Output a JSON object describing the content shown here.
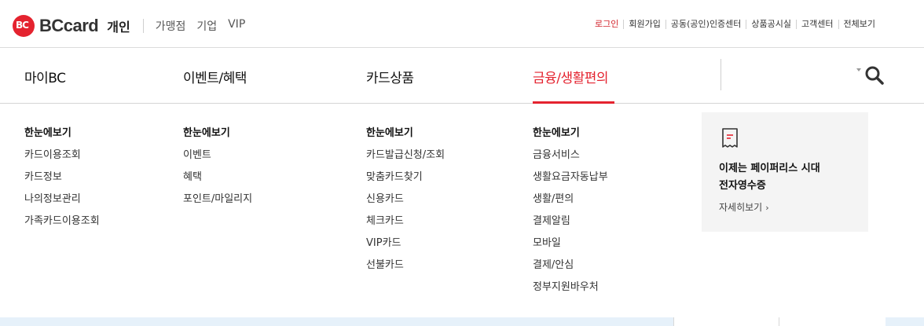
{
  "brand": {
    "logo_mark": "BC",
    "logo_text": "BCcard",
    "segment": "개인",
    "segment_links": [
      "가맹점",
      "기업",
      "VIP"
    ]
  },
  "utility_nav": [
    "로그인",
    "회원가입",
    "공동(공인)인증센터",
    "상품공시실",
    "고객센터",
    "전체보기"
  ],
  "gnb": {
    "items": [
      "마이BC",
      "이벤트/혜택",
      "카드상품",
      "금융/생활편의"
    ],
    "active_index": 3,
    "search_placeholder": ""
  },
  "menu_columns": [
    {
      "head": "한눈에보기",
      "links": [
        "카드이용조회",
        "카드정보",
        "나의정보관리",
        "가족카드이용조회"
      ]
    },
    {
      "head": "한눈에보기",
      "links": [
        "이벤트",
        "혜택",
        "포인트/마일리지"
      ]
    },
    {
      "head": "한눈에보기",
      "links": [
        "카드발급신청/조회",
        "맞춤카드찾기",
        "신용카드",
        "체크카드",
        "VIP카드",
        "선불카드"
      ]
    },
    {
      "head": "한눈에보기",
      "links": [
        "금융서비스",
        "생활요금자동납부",
        "생활/편의",
        "결제알림",
        "모바일",
        "결제/안심",
        "정부지원바우처"
      ]
    }
  ],
  "promo": {
    "icon": "receipt-icon",
    "title": "이제는 페이퍼리스 시대\n전자영수증",
    "more": "자세히보기",
    "more_icon": "chevron-right-icon"
  },
  "colors": {
    "accent": "#e4232f",
    "promo_bg": "#f4f4f4",
    "bottom_strip": "#e6f1fa"
  }
}
